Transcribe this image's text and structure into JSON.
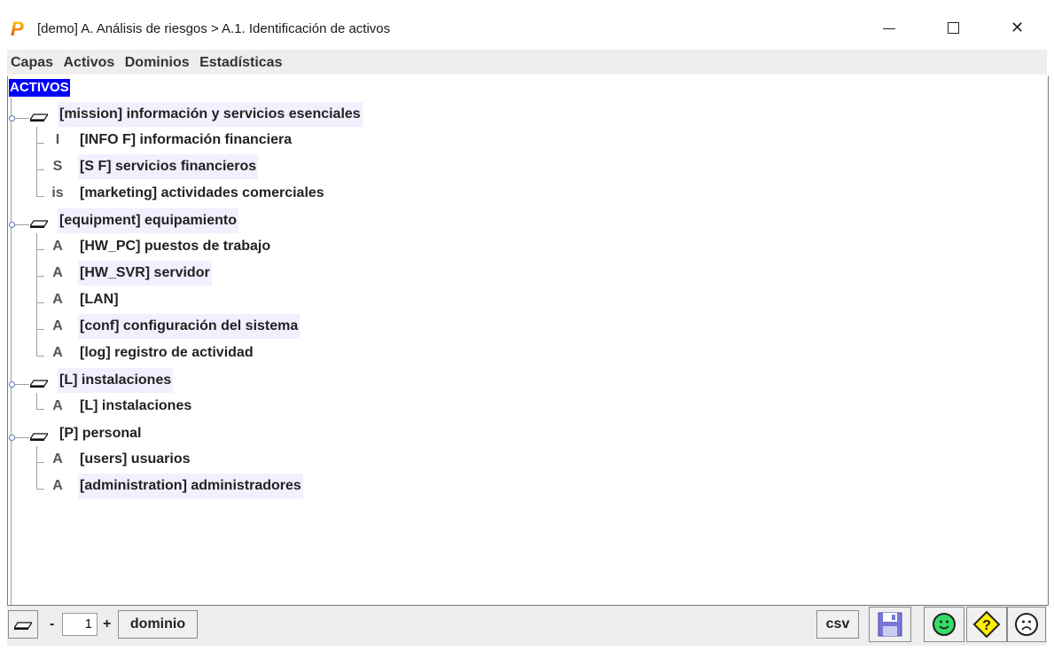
{
  "window": {
    "title": "[demo] A. Análisis de riesgos > A.1. Identificación de activos",
    "app_icon_letter": "P"
  },
  "menu": {
    "items": [
      "Capas",
      "Activos",
      "Dominios",
      "Estadísticas"
    ]
  },
  "tree": {
    "root_label": "ACTIVOS",
    "groups": [
      {
        "label": "[mission] información y servicios esenciales",
        "children": [
          {
            "prefix": "I",
            "label": "[INFO F] información financiera"
          },
          {
            "prefix": "S",
            "label": "[S F] servicios financieros"
          },
          {
            "prefix": "is",
            "label": "[marketing] actividades comerciales"
          }
        ]
      },
      {
        "label": "[equipment] equipamiento",
        "children": [
          {
            "prefix": "A",
            "label": "[HW_PC] puestos de trabajo"
          },
          {
            "prefix": "A",
            "label": "[HW_SVR] servidor"
          },
          {
            "prefix": "A",
            "label": "[LAN]"
          },
          {
            "prefix": "A",
            "label": "[conf] configuración del sistema"
          },
          {
            "prefix": "A",
            "label": "[log] registro de actividad"
          }
        ]
      },
      {
        "label": "[L] instalaciones",
        "children": [
          {
            "prefix": "A",
            "label": "[L] instalaciones"
          }
        ]
      },
      {
        "label": "[P] personal",
        "children": [
          {
            "prefix": "A",
            "label": "[users] usuarios"
          },
          {
            "prefix": "A",
            "label": "[administration] administradores"
          }
        ]
      }
    ]
  },
  "bottom": {
    "minus_label": "-",
    "level_value": "1",
    "plus_label": "+",
    "domain_button": "dominio",
    "csv_button": "csv",
    "save_icon": "floppy-disk-icon",
    "icons": [
      "layers-icon",
      "happy-face-icon",
      "question-warning-icon",
      "sad-face-icon"
    ]
  },
  "colors": {
    "root_highlight": "#0000ff",
    "node_highlight": "#f0f0ff",
    "happy_face": "#33dd66",
    "warning": "#ffee00"
  }
}
